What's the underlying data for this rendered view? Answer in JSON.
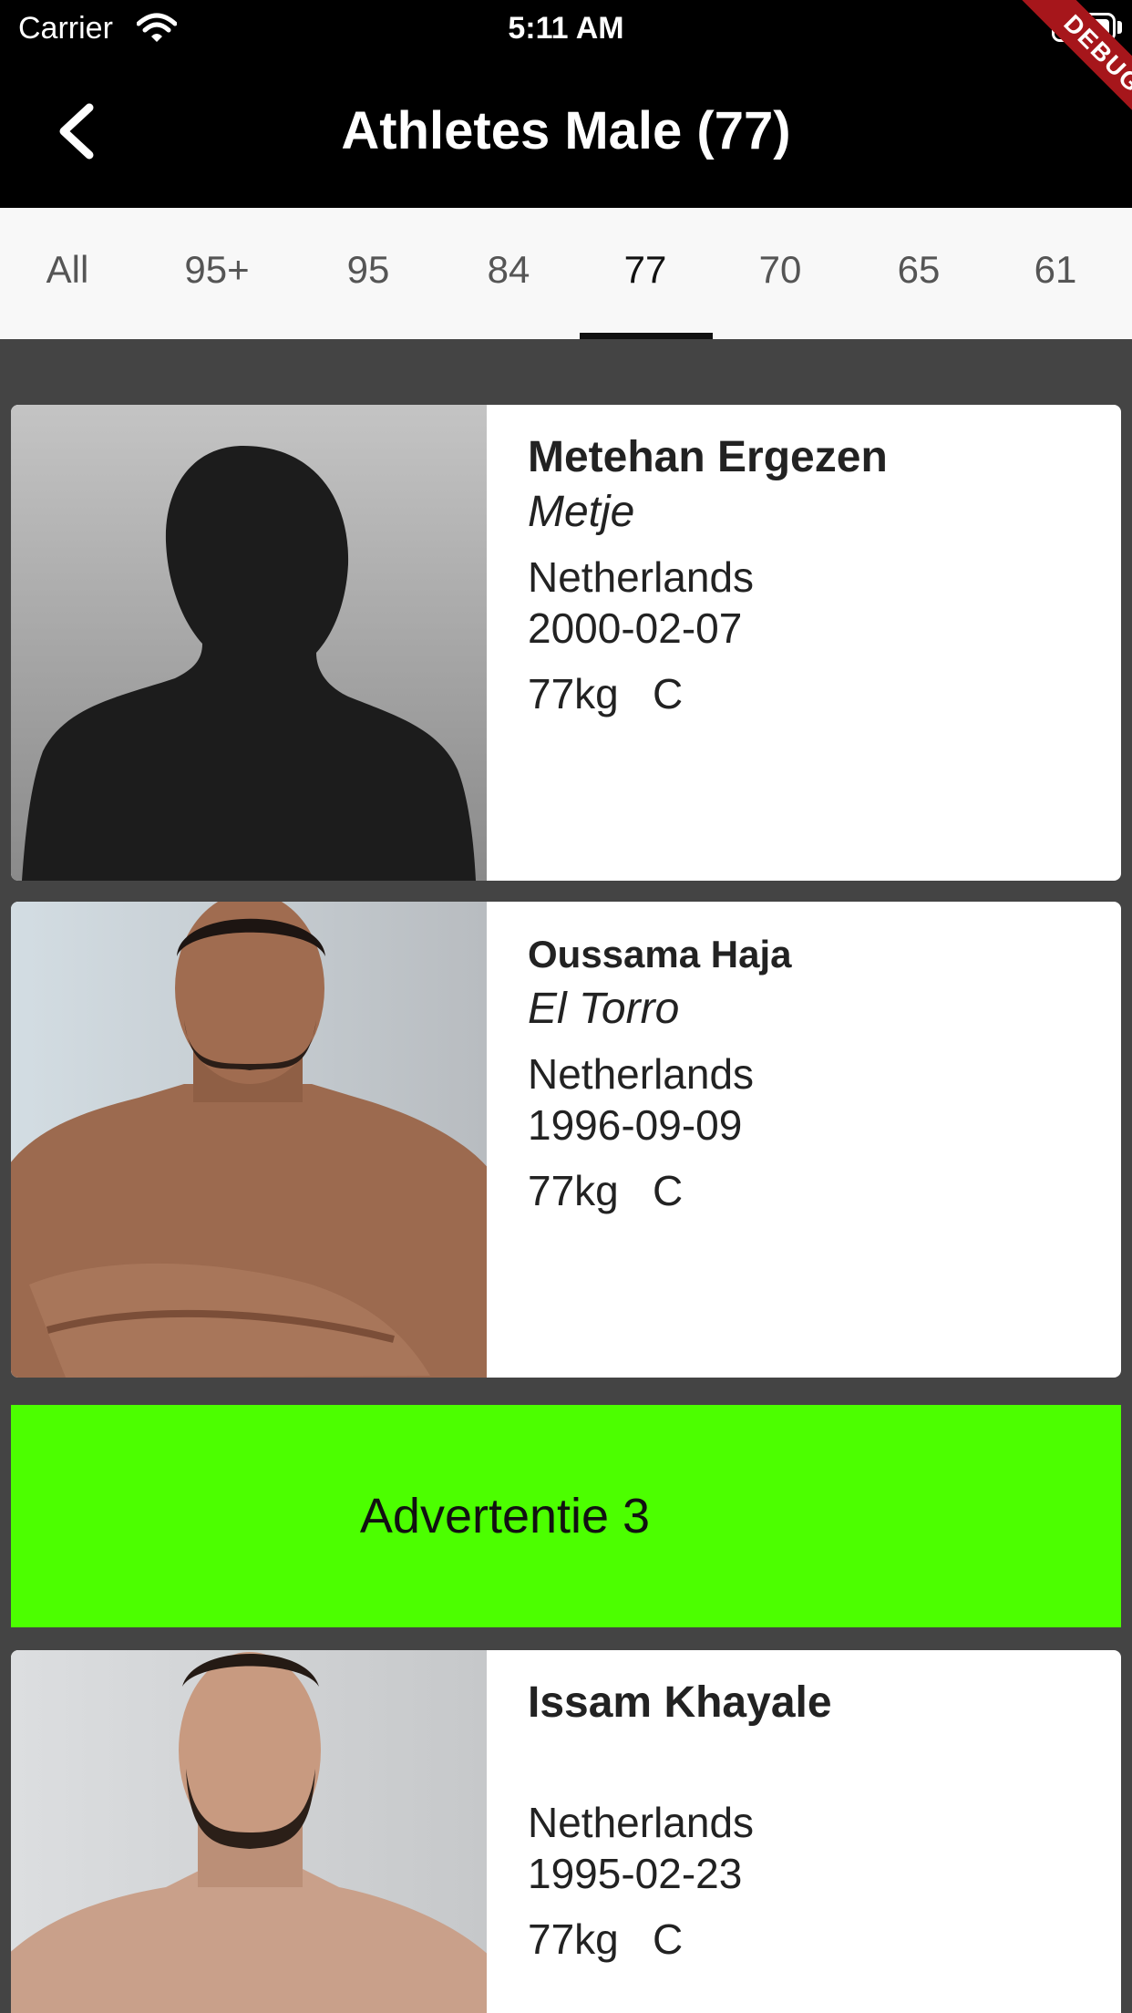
{
  "status_bar": {
    "carrier": "Carrier",
    "time": "5:11 AM",
    "debug_label": "DEBUG"
  },
  "nav": {
    "title": "Athletes Male (77)",
    "back_icon": "chevron-left-icon"
  },
  "tabs": {
    "items": [
      "All",
      "95+",
      "95",
      "84",
      "77",
      "70",
      "65",
      "61"
    ],
    "selected": "77"
  },
  "athletes": [
    {
      "name": "Metehan Ergezen",
      "nickname": "Metje",
      "country": "Netherlands",
      "dob": "2000-02-07",
      "weight": "77kg",
      "division": "C"
    },
    {
      "name": "Oussama Haja",
      "nickname": "El Torro",
      "country": "Netherlands",
      "dob": "1996-09-09",
      "weight": "77kg",
      "division": "C"
    },
    {
      "name": "Issam Khayale",
      "nickname": "",
      "country": "Netherlands",
      "dob": "1995-02-23",
      "weight": "77kg",
      "division": "C"
    }
  ],
  "ad": {
    "label": "Advertentie 3",
    "color": "#4cff00"
  },
  "colors": {
    "header_bg": "#000000",
    "list_bg": "#444444",
    "tab_bg": "#f8f8f8",
    "debug_ribbon": "#a6161b"
  }
}
